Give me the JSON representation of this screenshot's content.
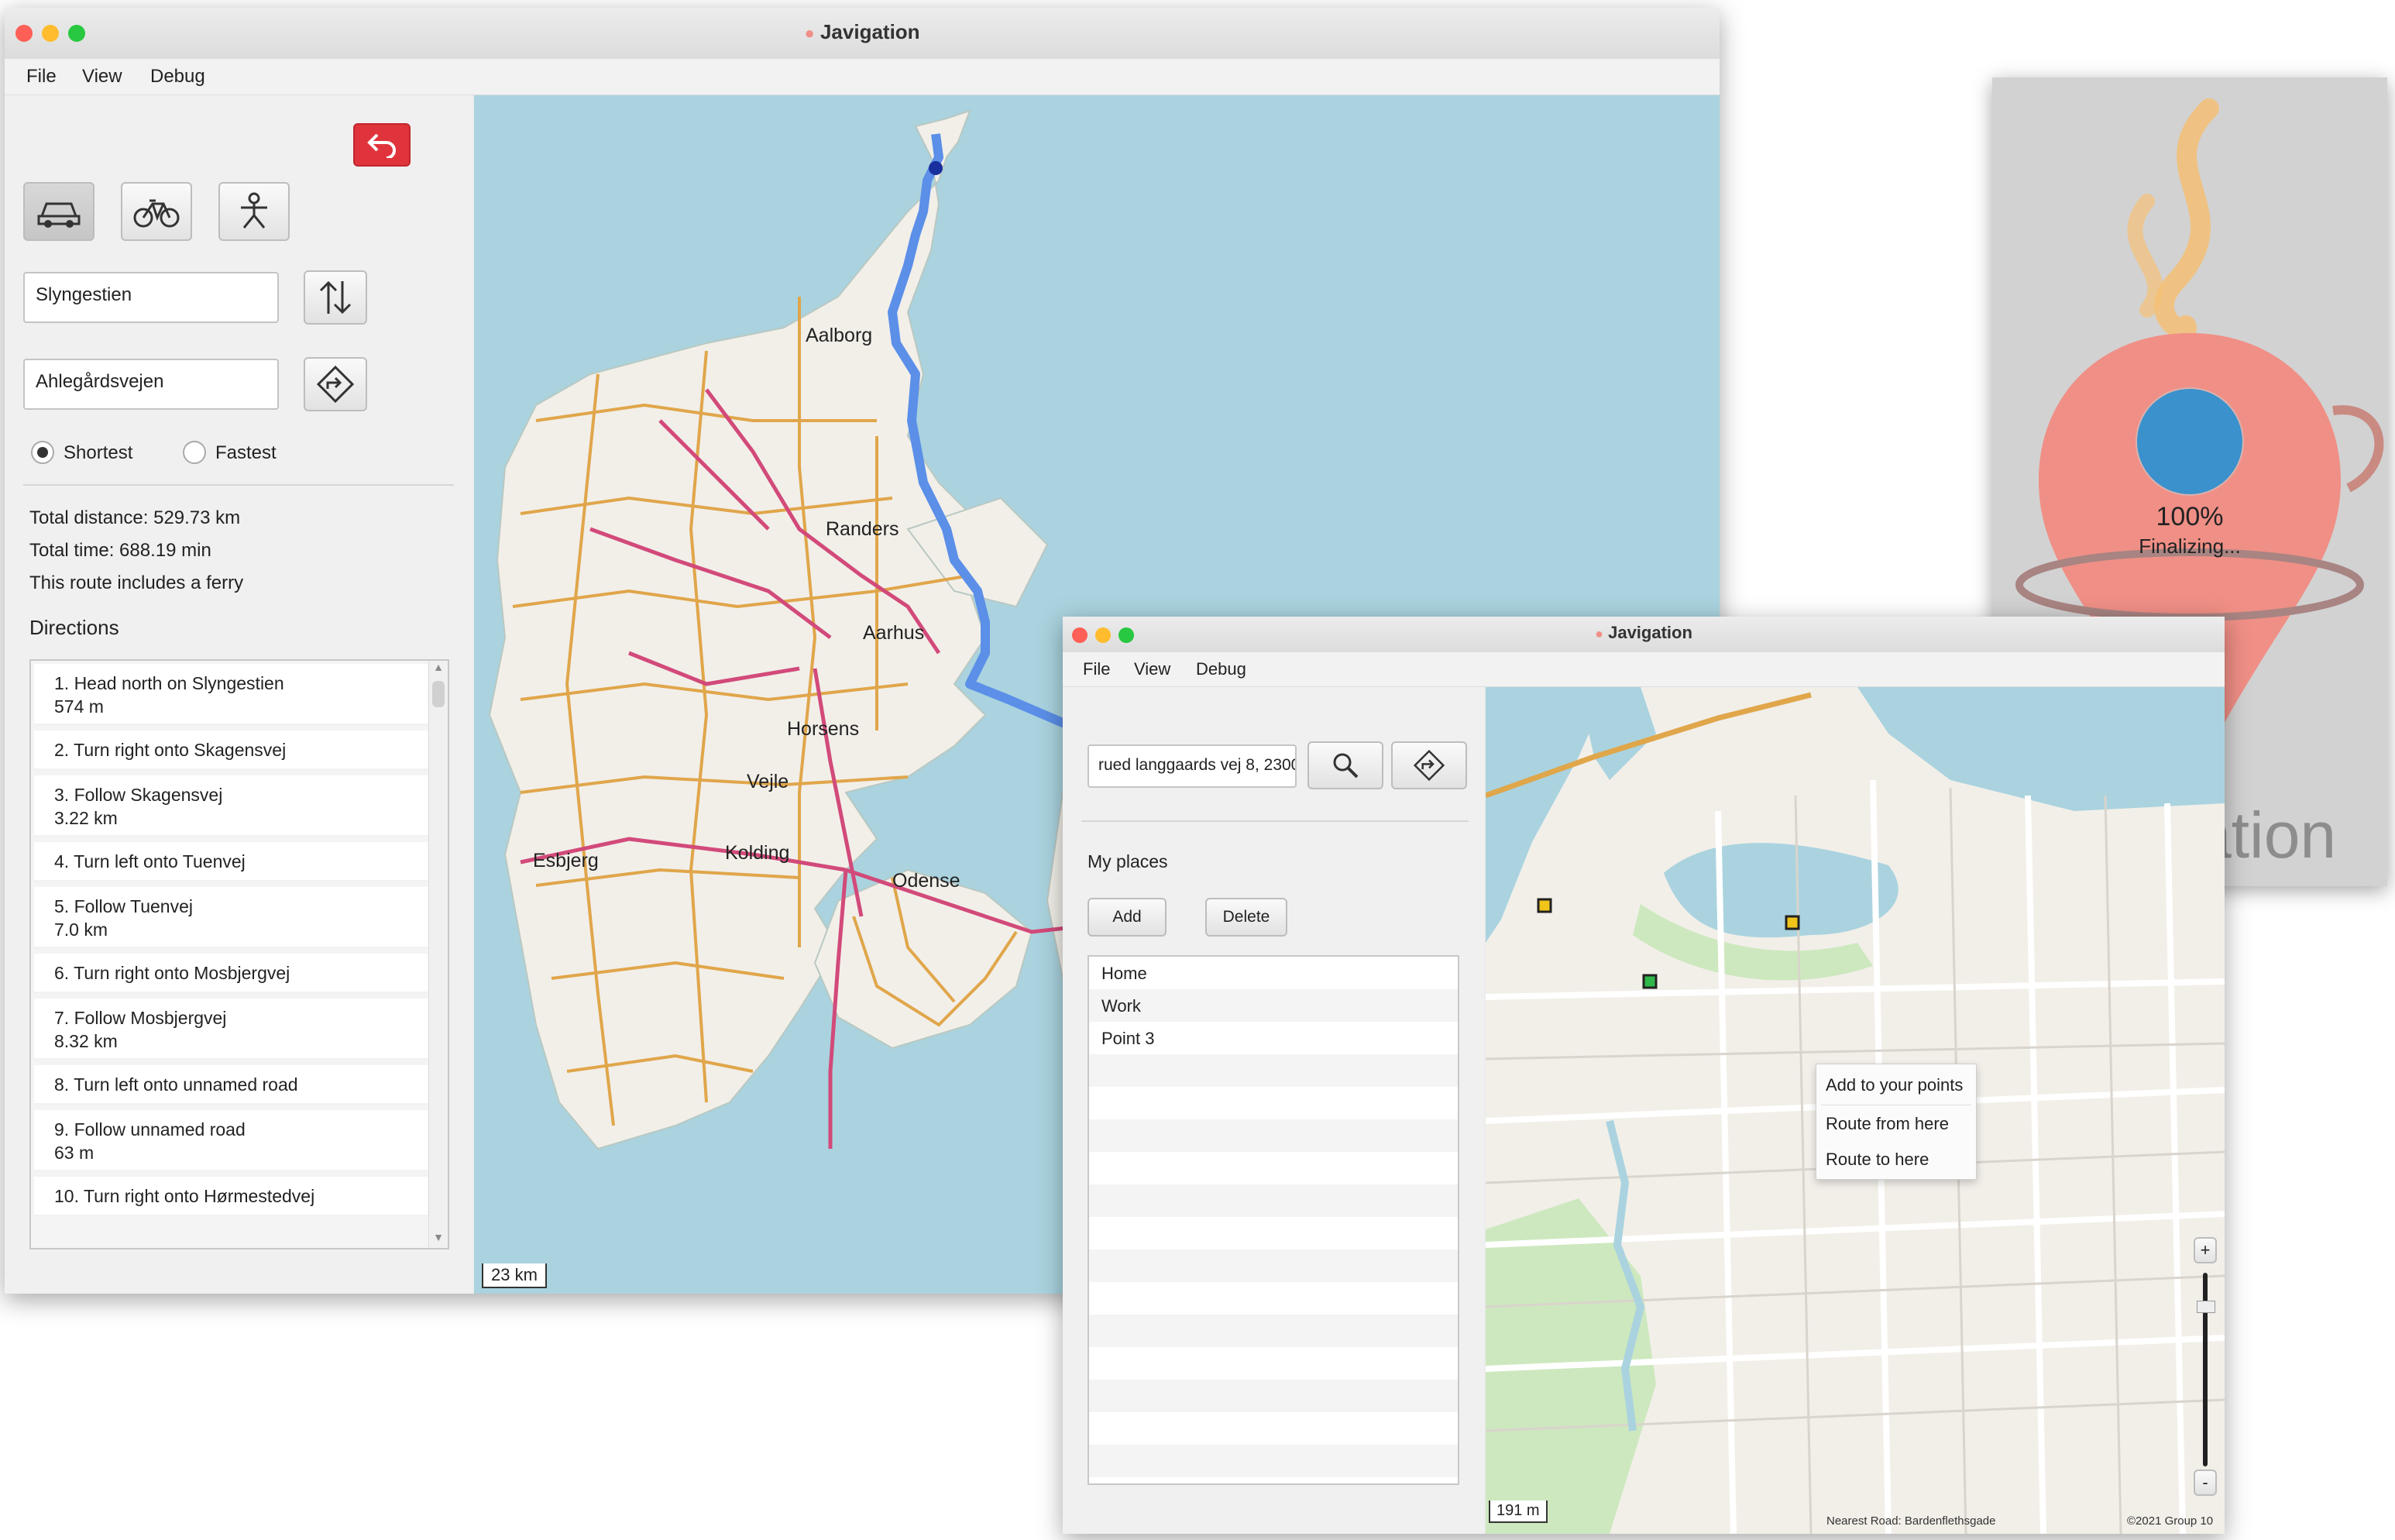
{
  "main_window": {
    "title": "Javigation",
    "menu": [
      "File",
      "View",
      "Debug"
    ],
    "origin_value": "Slyngestien",
    "destination_value": "Ahlegårdsvejen",
    "route_options": [
      {
        "label": "Shortest",
        "selected": true
      },
      {
        "label": "Fastest",
        "selected": false
      }
    ],
    "summary": {
      "distance": "Total distance: 529.73 km",
      "time": "Total time: 688.19 min",
      "ferry": "This route includes a ferry"
    },
    "directions_heading": "Directions",
    "directions": [
      {
        "line1": "1. Head north on Slyngestien",
        "line2": "574 m"
      },
      {
        "line1": "2. Turn right onto Skagensvej",
        "line2": ""
      },
      {
        "line1": "3. Follow Skagensvej",
        "line2": "3.22 km"
      },
      {
        "line1": "4. Turn left onto Tuenvej",
        "line2": ""
      },
      {
        "line1": "5. Follow Tuenvej",
        "line2": "7.0 km"
      },
      {
        "line1": "6. Turn right onto Mosbjergvej",
        "line2": ""
      },
      {
        "line1": "7. Follow Mosbjergvej",
        "line2": "8.32 km"
      },
      {
        "line1": "8. Turn left onto unnamed road",
        "line2": ""
      },
      {
        "line1": "9. Follow unnamed road",
        "line2": "63 m"
      },
      {
        "line1": "10. Turn right onto Hørmestedvej",
        "line2": ""
      }
    ],
    "map_labels": {
      "aalborg": "Aalborg",
      "randers": "Randers",
      "aarhus": "Aarhus",
      "horsens": "Horsens",
      "vejle": "Vejle",
      "esbjerg": "Esbjerg",
      "kolding": "Kolding",
      "odense": "Odense"
    },
    "scale": "23 km"
  },
  "second_window": {
    "title": "Javigation",
    "menu": [
      "File",
      "View",
      "Debug"
    ],
    "search_value": "rued langgaards vej 8, 2300",
    "my_places_heading": "My places",
    "add_label": "Add",
    "delete_label": "Delete",
    "places": [
      "Home",
      "Work",
      "Point 3"
    ],
    "context_menu": [
      "Add to your points",
      "Route from here",
      "Route to here"
    ],
    "scale": "191 m",
    "nearest_road": "Nearest Road: Bardenflethsgade",
    "copyright": "©2021 Group 10",
    "zoom_in": "+",
    "zoom_out": "-"
  },
  "splash": {
    "progress_percent": "100%",
    "progress_fraction": 1.0,
    "status": "Finalizing...",
    "brand": "Javigation"
  },
  "colors": {
    "sea": "#aad3df",
    "land": "#f2efe9",
    "route": "#5b8fe8",
    "major_road": "#d24a7a",
    "secondary_road": "#e0a64a",
    "back_button": "#e0343d",
    "splash_pin": "#f08f86",
    "splash_progress": "#3b91cc"
  }
}
